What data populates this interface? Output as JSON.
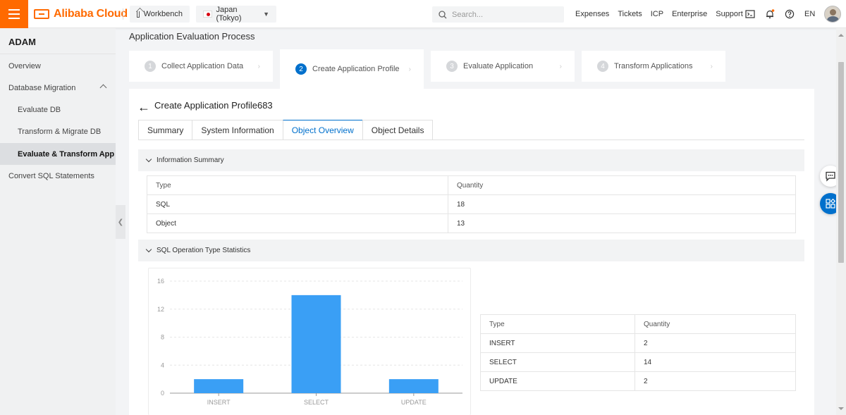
{
  "topbar": {
    "brand": "Alibaba Cloud",
    "workbench_label": "Workbench",
    "region_label": "Japan (Tokyo)",
    "search_placeholder": "Search...",
    "nav_links": [
      "Expenses",
      "Tickets",
      "ICP",
      "Enterprise",
      "Support"
    ],
    "language": "EN",
    "accent_color": "#ff6a00"
  },
  "sidebar": {
    "title": "ADAM",
    "items": [
      {
        "label": "Overview"
      },
      {
        "label": "Database Migration"
      },
      {
        "label": "Evaluate DB"
      },
      {
        "label": "Transform & Migrate DB"
      },
      {
        "label": "Evaluate & Transform App"
      },
      {
        "label": "Convert SQL Statements"
      }
    ]
  },
  "main": {
    "page_title": "Application Evaluation Process",
    "steps": [
      {
        "num": "1",
        "label": "Collect Application Data"
      },
      {
        "num": "2",
        "label": "Create Application Profile"
      },
      {
        "num": "3",
        "label": "Evaluate Application"
      },
      {
        "num": "4",
        "label": "Transform Applications"
      }
    ],
    "active_step": 2,
    "profile_title": "Create Application Profile683",
    "tabs": [
      "Summary",
      "System Information",
      "Object Overview",
      "Object Details"
    ],
    "active_tab": "Object Overview",
    "info_summary": {
      "title": "Information Summary",
      "headers": [
        "Type",
        "Quantity"
      ],
      "rows": [
        [
          "SQL",
          "18"
        ],
        [
          "Object",
          "13"
        ]
      ]
    },
    "sql_stats": {
      "title": "SQL Operation Type Statistics",
      "headers": [
        "Type",
        "Quantity"
      ],
      "rows": [
        [
          "INSERT",
          "2"
        ],
        [
          "SELECT",
          "14"
        ],
        [
          "UPDATE",
          "2"
        ]
      ]
    },
    "primary_color": "#0070cc",
    "bar_color": "#3a9ff5"
  },
  "chart_data": {
    "type": "bar",
    "categories": [
      "INSERT",
      "SELECT",
      "UPDATE"
    ],
    "values": [
      2,
      14,
      2
    ],
    "yticks": [
      0,
      4,
      8,
      12,
      16
    ],
    "ylim": [
      0,
      16
    ],
    "grid": true
  }
}
